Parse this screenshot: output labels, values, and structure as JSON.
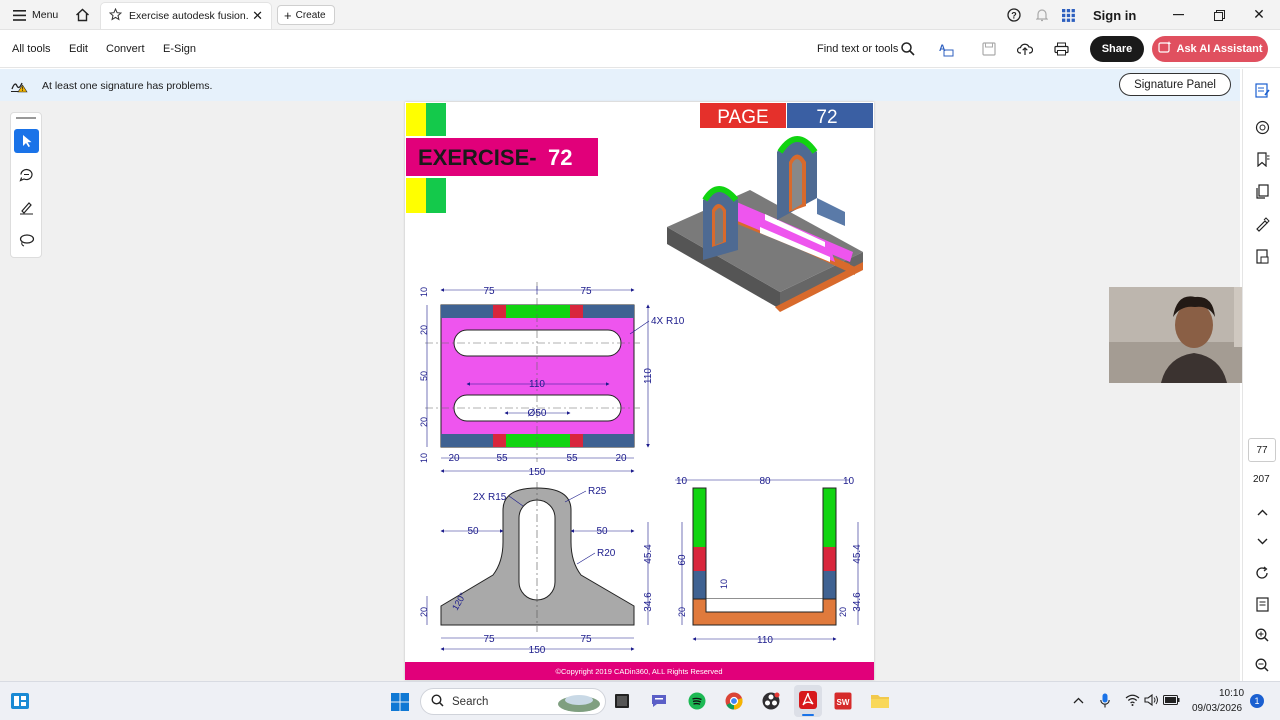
{
  "tabbar": {
    "menu_label": "Menu",
    "tab_title": "Exercise autodesk fusion..",
    "create_label": "Create",
    "signin_label": "Sign in"
  },
  "toolbar": {
    "all_tools": "All tools",
    "edit": "Edit",
    "convert": "Convert",
    "esign": "E-Sign",
    "find_label": "Find text or tools",
    "share_label": "Share",
    "ask_ai_label": "Ask AI Assistant"
  },
  "notice": {
    "message": "At least one signature has problems.",
    "signature_panel": "Signature Panel"
  },
  "page_nav": {
    "current": "77",
    "total": "207"
  },
  "document": {
    "page_label": "PAGE",
    "page_number": "72",
    "exercise_label": "EXERCISE-",
    "exercise_number": "72",
    "copyright": "©Copyright 2019 CADin360, ALL Rights Reserved",
    "dims_top": [
      "10",
      "75",
      "75",
      "20",
      "50",
      "20",
      "10",
      "4X R10",
      "110",
      "110",
      "Ø50",
      "20",
      "55",
      "55",
      "20",
      "150"
    ],
    "dims_front": [
      "2X R15",
      "R25",
      "50",
      "50",
      "R20",
      "45.4",
      "34.6",
      "20",
      "120°",
      "75",
      "75",
      "150"
    ],
    "dims_side": [
      "10",
      "80",
      "10",
      "60",
      "10",
      "20",
      "45.4",
      "34.6",
      "20",
      "110"
    ]
  },
  "taskbar": {
    "search_label": "Search",
    "time": "10:10",
    "date": "09/03/2026",
    "notif_count": "1"
  },
  "colors": {
    "accent_red": "#e5302b",
    "magenta": "#e1007a",
    "page_blue": "#3a5fa3",
    "drawing_pink": "#ee55ee",
    "drawing_blue": "#3f6292",
    "drawing_green": "#11d411",
    "drawing_red": "#d8263c",
    "drawing_orange": "#e07a3c",
    "dim_blue": "#1c1c8c"
  }
}
